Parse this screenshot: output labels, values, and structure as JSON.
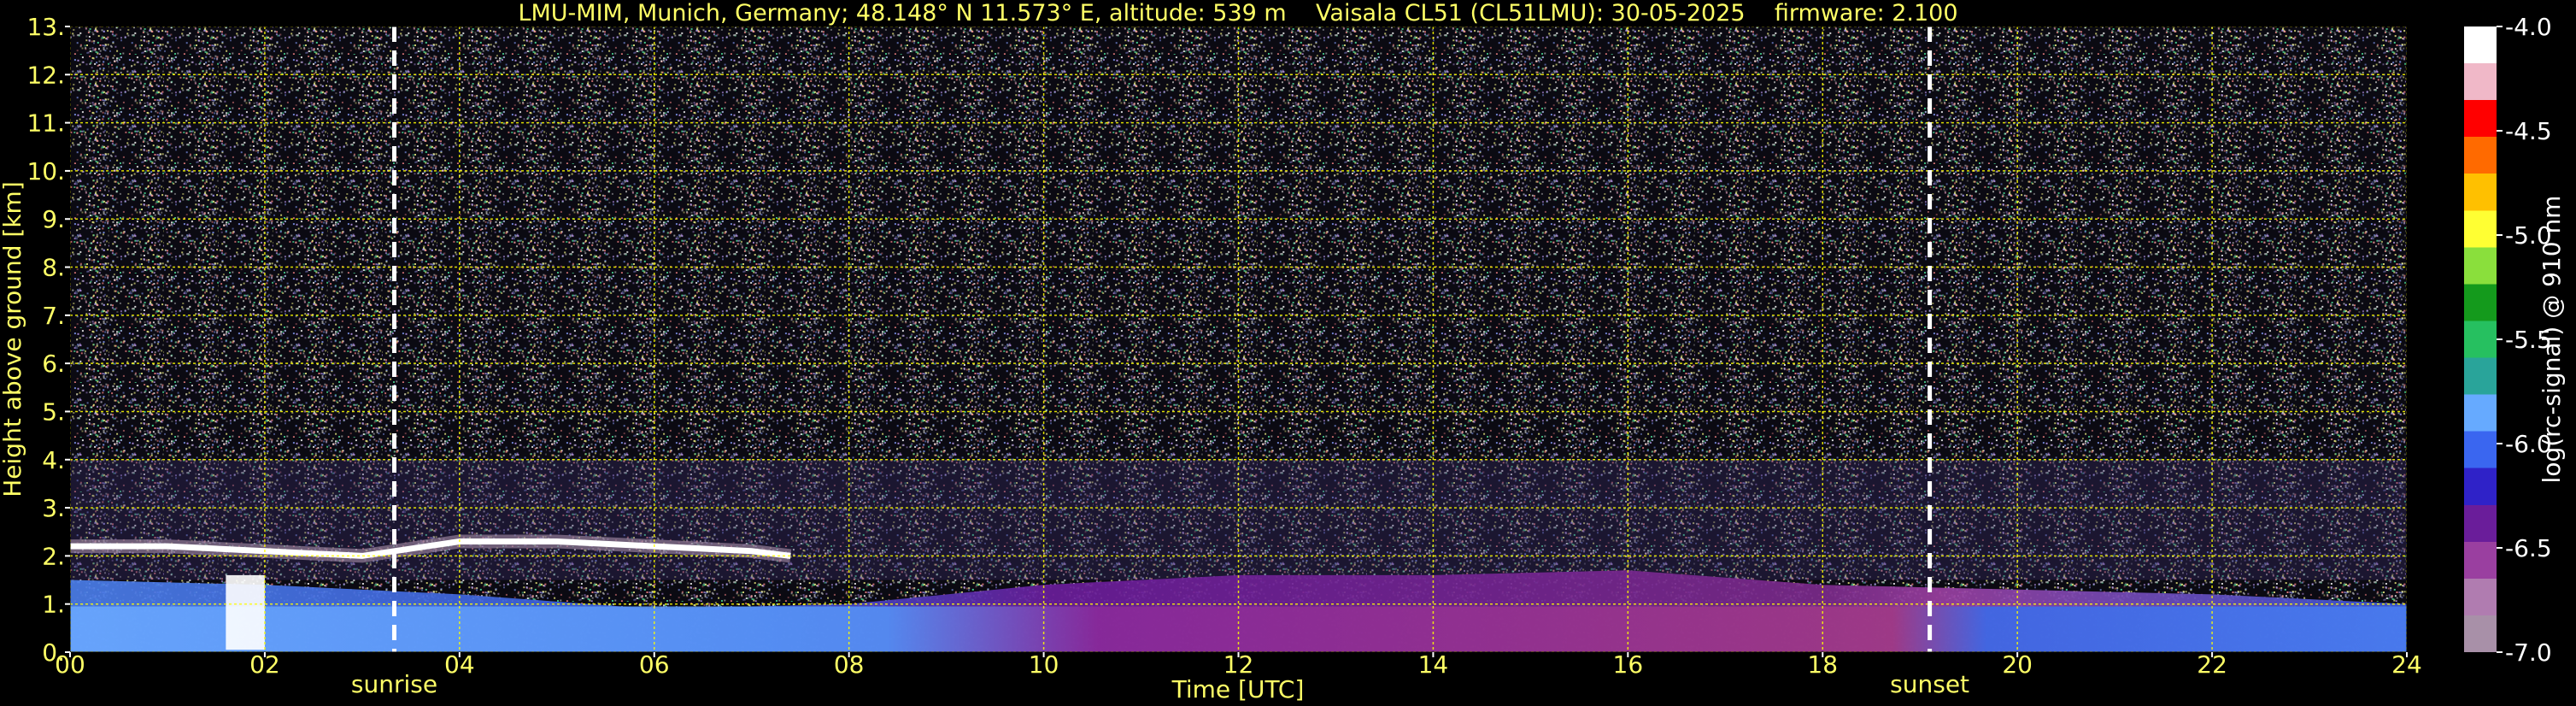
{
  "chart_data": {
    "type": "heatmap",
    "title": "LMU-MIM, Munich, Germany; 48.148° N 11.573° E, altitude: 539 m    Vaisala CL51 (CL51LMU): 30-05-2025    firmware: 2.100",
    "xlabel": "Time [UTC]",
    "ylabel": "Height above ground [km]",
    "colorbar_label": "log(rc-signal) @ 910 nm",
    "xlim": [
      0,
      24
    ],
    "ylim": [
      0,
      13
    ],
    "clim": [
      -7.0,
      -4.0
    ],
    "grid": true,
    "x_ticks": [
      0,
      2,
      4,
      6,
      8,
      10,
      12,
      14,
      16,
      18,
      20,
      22,
      24
    ],
    "x_tick_labels": [
      "00",
      "02",
      "04",
      "06",
      "08",
      "10",
      "12",
      "14",
      "16",
      "18",
      "20",
      "22",
      "24"
    ],
    "y_ticks": [
      0,
      1,
      2,
      3,
      4,
      5,
      6,
      7,
      8,
      9,
      10,
      11,
      12,
      13
    ],
    "y_tick_labels": [
      "0.",
      "1.",
      "2.",
      "3.",
      "4.",
      "5.",
      "6.",
      "7.",
      "8.",
      "9.",
      "10.",
      "11.",
      "12.",
      "13."
    ],
    "colorbar_ticks": [
      -7.0,
      -6.5,
      -6.0,
      -5.5,
      -5.0,
      -4.5,
      -4.0
    ],
    "colorbar_tick_labels": [
      "-7.0",
      "-6.5",
      "-6.0",
      "-5.5",
      "-5.0",
      "-4.5",
      "-4.0"
    ],
    "annotations": [
      {
        "text": "sunrise",
        "x": 3.33
      },
      {
        "text": "sunset",
        "x": 19.1
      }
    ],
    "vertical_lines": [
      3.33,
      19.1
    ],
    "cloud_layer": [
      {
        "x": 0.0,
        "y": 2.2
      },
      {
        "x": 1.0,
        "y": 2.2
      },
      {
        "x": 2.0,
        "y": 2.1
      },
      {
        "x": 3.0,
        "y": 2.0
      },
      {
        "x": 4.0,
        "y": 2.3
      },
      {
        "x": 5.0,
        "y": 2.3
      },
      {
        "x": 6.0,
        "y": 2.2
      },
      {
        "x": 7.0,
        "y": 2.1
      },
      {
        "x": 7.4,
        "y": 2.0
      }
    ],
    "aerosol_layer_top": [
      {
        "x": 0,
        "y": 1.5
      },
      {
        "x": 2,
        "y": 1.4
      },
      {
        "x": 4,
        "y": 1.2
      },
      {
        "x": 6,
        "y": 0.9
      },
      {
        "x": 8,
        "y": 1.0
      },
      {
        "x": 10,
        "y": 1.4
      },
      {
        "x": 12,
        "y": 1.6
      },
      {
        "x": 14,
        "y": 1.6
      },
      {
        "x": 16,
        "y": 1.7
      },
      {
        "x": 18,
        "y": 1.4
      },
      {
        "x": 20,
        "y": 1.3
      },
      {
        "x": 22,
        "y": 1.2
      },
      {
        "x": 24,
        "y": 1.0
      }
    ],
    "colors": {
      "text": "#ffff66",
      "grid": "#ffff00",
      "marker_line": "#ffffff",
      "colormap": [
        "#a890a8",
        "#b07cb0",
        "#9a3fa0",
        "#6a1d9a",
        "#2f22c8",
        "#3a66f0",
        "#66aaff",
        "#29a49a",
        "#26c060",
        "#149a1c",
        "#8adf3c",
        "#ffff33",
        "#ffc000",
        "#ff6a00",
        "#ff0000",
        "#f0b8c8",
        "#ffffff"
      ]
    }
  }
}
